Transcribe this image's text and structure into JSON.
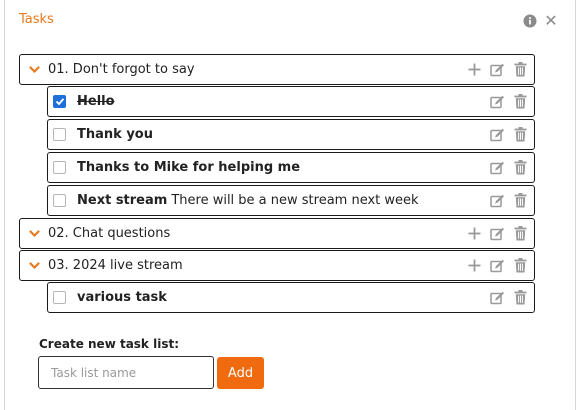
{
  "panel": {
    "title": "Tasks",
    "accent_color": "#e8791c",
    "button_color": "#f06a0f",
    "checkbox_color": "#1e6fd9"
  },
  "task_lists": [
    {
      "name": "01. Don't forgot to say",
      "expanded": true,
      "tasks": [
        {
          "title": "Hello",
          "description": "",
          "done": true
        },
        {
          "title": "Thank you",
          "description": "",
          "done": false
        },
        {
          "title": "Thanks to Mike for helping me",
          "description": "",
          "done": false
        },
        {
          "title": "Next stream",
          "description": "There will be a new stream next week",
          "done": false
        }
      ]
    },
    {
      "name": "02. Chat questions",
      "expanded": true,
      "tasks": []
    },
    {
      "name": "03. 2024 live stream",
      "expanded": true,
      "tasks": [
        {
          "title": "various task",
          "description": "",
          "done": false
        }
      ]
    }
  ],
  "create_form": {
    "label": "Create new task list:",
    "input_value": "",
    "input_placeholder": "Task list name",
    "add_label": "Add"
  },
  "icons": {
    "header": [
      "info-icon",
      "close-icon"
    ],
    "list_row": [
      "chevron-down-icon",
      "add-icon",
      "edit-icon",
      "trash-icon"
    ],
    "task_row": [
      "checkbox",
      "edit-icon",
      "trash-icon"
    ]
  }
}
